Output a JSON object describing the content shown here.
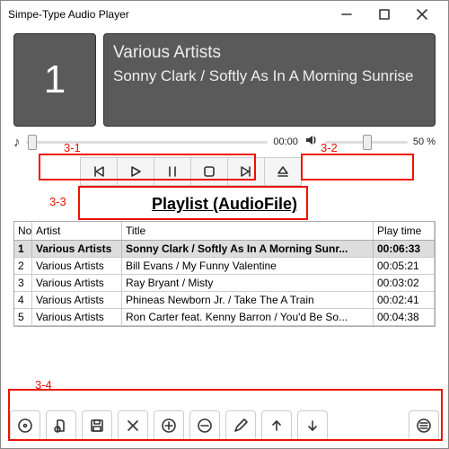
{
  "window": {
    "title": "Simpe-Type Audio Player"
  },
  "nowplaying": {
    "tracknum": "1",
    "artist": "Various Artists",
    "title": "Sonny Clark / Softly As In A Morning Sunrise"
  },
  "time": "00:00",
  "volume_pct": "50 %",
  "playlist_title": "Playlist (AudioFile)",
  "columns": {
    "no": "No",
    "artist": "Artist",
    "title": "Title",
    "time": "Play time"
  },
  "rows": [
    {
      "no": "1",
      "artist": "Various Artists",
      "title": "Sonny Clark / Softly As In A Morning Sunr...",
      "time": "00:06:33"
    },
    {
      "no": "2",
      "artist": "Various Artists",
      "title": "Bill Evans / My Funny Valentine",
      "time": "00:05:21"
    },
    {
      "no": "3",
      "artist": "Various Artists",
      "title": "Ray Bryant / Misty",
      "time": "00:03:02"
    },
    {
      "no": "4",
      "artist": "Various Artists",
      "title": "Phineas Newborn Jr. / Take The A Train",
      "time": "00:02:41"
    },
    {
      "no": "5",
      "artist": "Various Artists",
      "title": "Ron Carter feat. Kenny Barron / You'd Be So...",
      "time": "00:04:38"
    }
  ],
  "annotations": {
    "a1": "3-1",
    "a2": "3-2",
    "a3": "3-3",
    "a4": "3-4"
  }
}
